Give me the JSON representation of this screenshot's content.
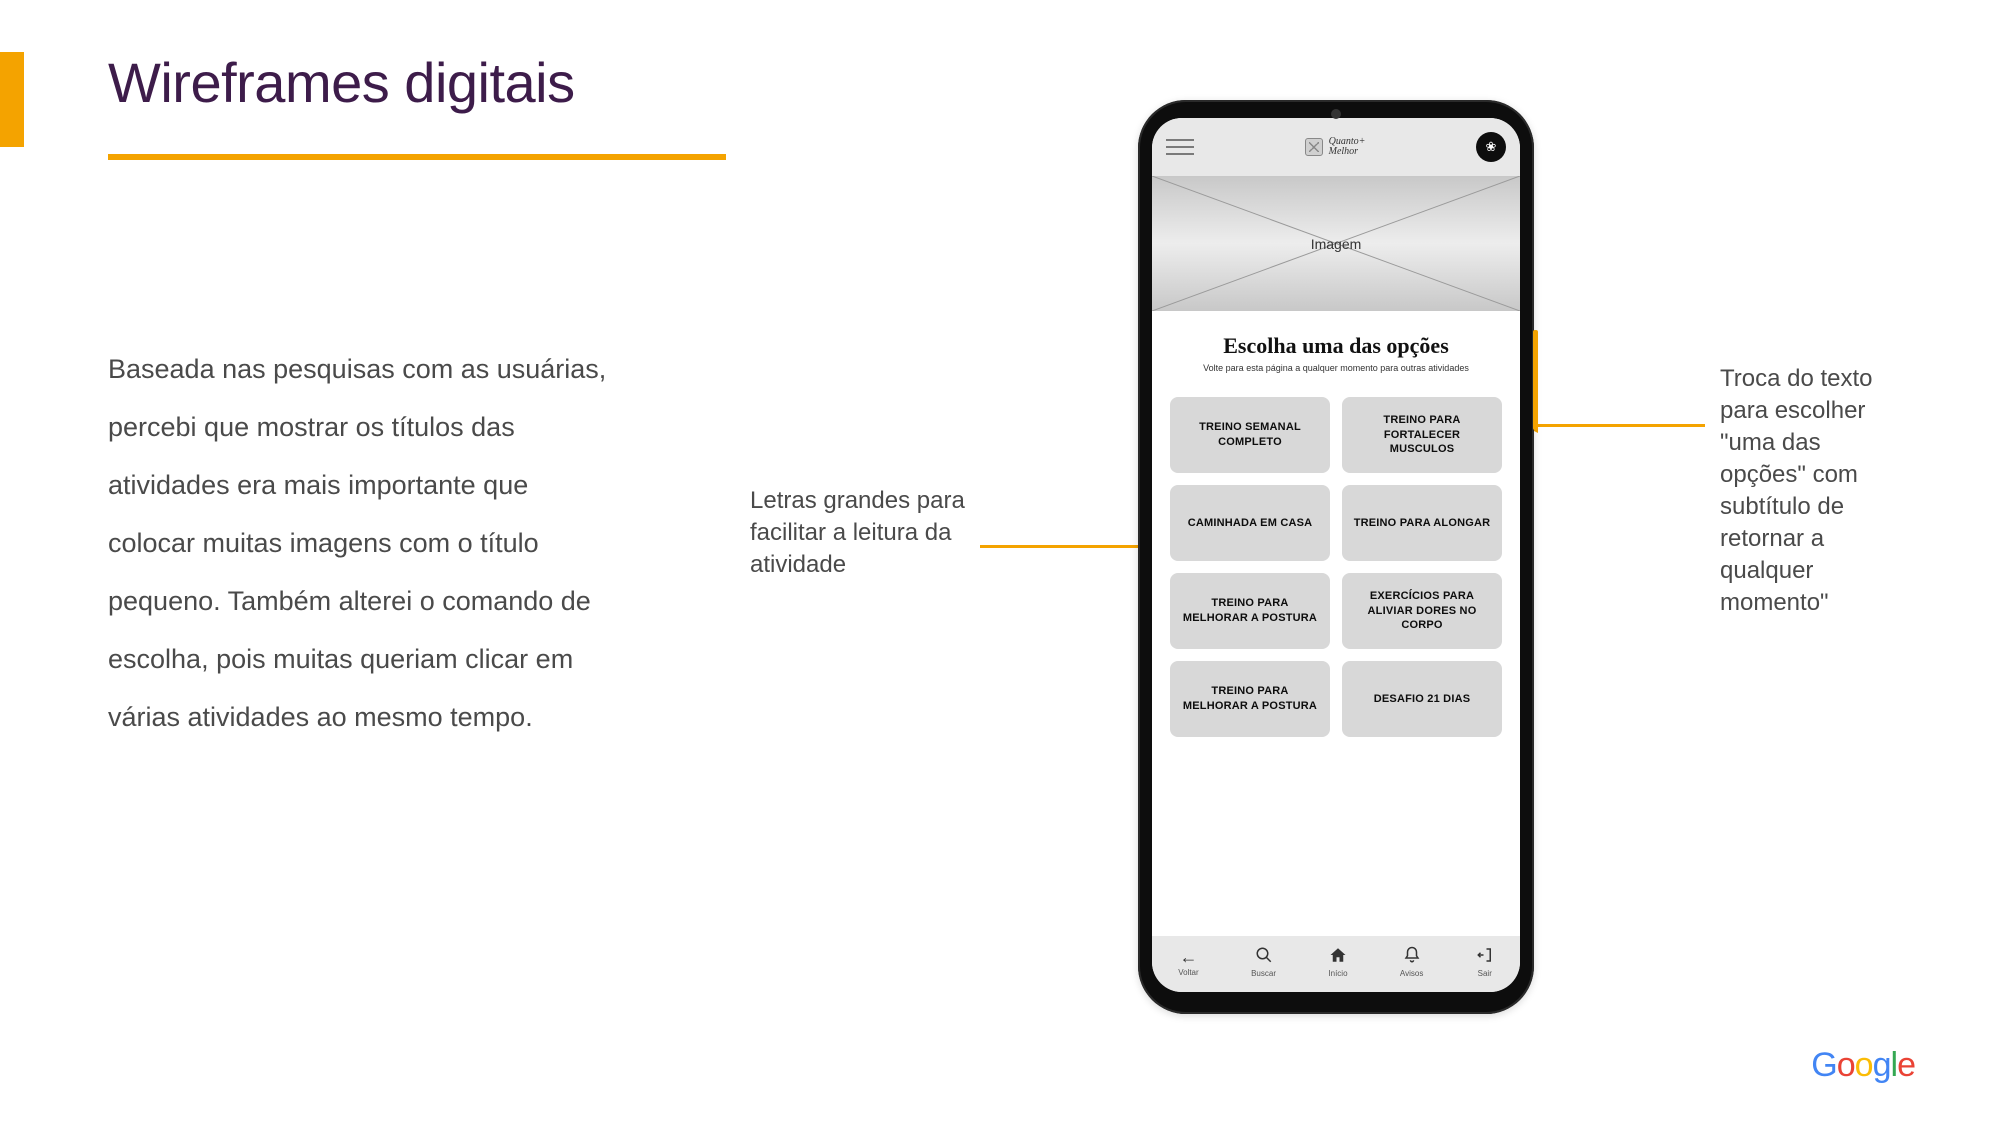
{
  "slide": {
    "title": "Wireframes digitais",
    "body_text": "Baseada nas pesquisas com as usuárias, percebi que mostrar os títulos das atividades era mais importante que colocar muitas imagens com o título pequeno. Também alterei o comando de escolha, pois muitas queriam clicar em várias atividades ao mesmo tempo."
  },
  "annotations": {
    "left": "Letras grandes para facilitar a leitura da atividade",
    "right": "Troca do texto para escolher \"uma das opções\" com subtítulo de retornar a qualquer momento\""
  },
  "app": {
    "logo_line1": "Quanto+",
    "logo_line2": "Melhor",
    "hero_placeholder": "Imagem",
    "choose_title": "Escolha uma das opções",
    "choose_subtitle": "Volte para esta página a qualquer momento para outras atividades",
    "cards": [
      "TREINO SEMANAL COMPLETO",
      "TREINO PARA FORTALECER MUSCULOS",
      "CAMINHADA EM CASA",
      "TREINO PARA ALONGAR",
      "TREINO PARA MELHORAR A POSTURA",
      "EXERCÍCIOS PARA ALIVIAR DORES NO CORPO",
      "TREINO PARA MELHORAR A POSTURA",
      "DESAFIO 21 DIAS"
    ],
    "nav": {
      "voltar": "Voltar",
      "buscar": "Buscar",
      "inicio": "Início",
      "avisos": "Avisos",
      "sair": "Sair"
    }
  },
  "footer": {
    "brand": "Google"
  }
}
